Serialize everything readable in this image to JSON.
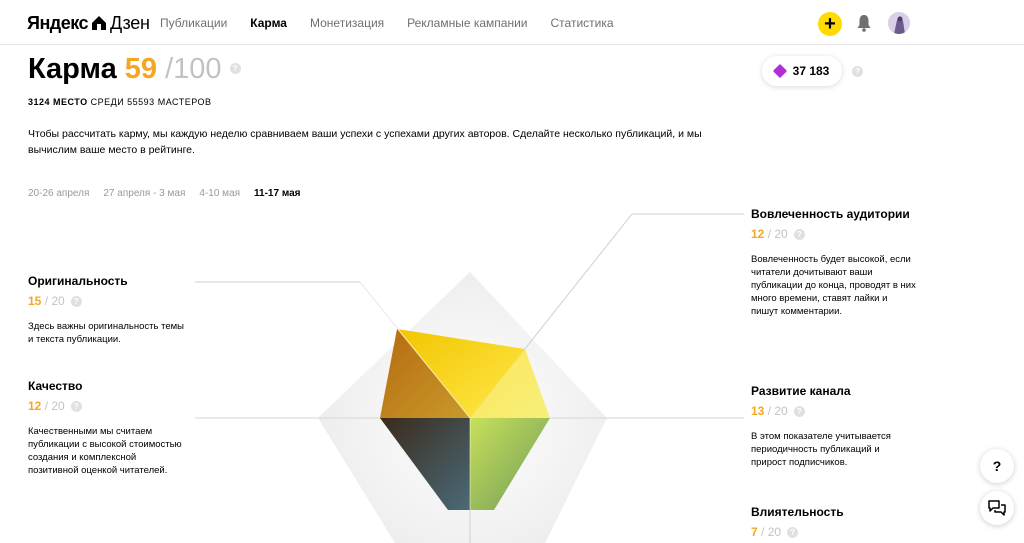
{
  "header": {
    "logo_text": "Яндекс",
    "logo_text2": "Дзен",
    "nav": [
      {
        "label": "Публикации",
        "active": false
      },
      {
        "label": "Карма",
        "active": true
      },
      {
        "label": "Монетизация",
        "active": false
      },
      {
        "label": "Рекламные кампании",
        "active": false
      },
      {
        "label": "Статистика",
        "active": false
      }
    ],
    "add_label": "+"
  },
  "karma": {
    "title": "Карма",
    "score": "59",
    "max": "/100",
    "rank_place": "3124 место",
    "rank_rest": "среди 55593 мастеров",
    "description": "Чтобы рассчитать карму, мы каждую неделю сравниваем ваши успехи с успехами других авторов. Сделайте несколько публикаций, и мы вычислим ваше место в рейтинге."
  },
  "weeks": [
    "20-26 апреля",
    "27 апреля - 3 мая",
    "4-10 мая",
    "11-17 мая"
  ],
  "active_week": "11-17 мая",
  "balance": {
    "value": "37 183"
  },
  "help_mark": "?",
  "metrics": {
    "originality": {
      "name": "Оригинальность",
      "value": "15",
      "max": "/ 20",
      "text": "Здесь важны оригинальность темы и текста публикации."
    },
    "quality": {
      "name": "Качество",
      "value": "12",
      "max": "/ 20",
      "text": "Качественными мы считаем публикации с высокой стоимостью создания и комплексной позитивной оценкой читателей."
    },
    "engagement": {
      "name": "Вовлеченность аудитории",
      "value": "12",
      "max": "/ 20",
      "text": "Вовлеченность будет высокой, если читатели дочитывают ваши публикации до конца, проводят в них много времени, ставят лайки и пишут комментарии."
    },
    "growth": {
      "name": "Развитие канала",
      "value": "13",
      "max": "/ 20",
      "text": "В этом показателе учитывается периодичность публикаций и прирост подписчиков."
    },
    "influence": {
      "name": "Влиятельность",
      "value": "7",
      "max": "/ 20"
    }
  },
  "fab": {
    "help": "?"
  },
  "colors": {
    "accent": "#f5a623",
    "yellow": "#ffdb00",
    "diamond": "#b32ed8"
  }
}
